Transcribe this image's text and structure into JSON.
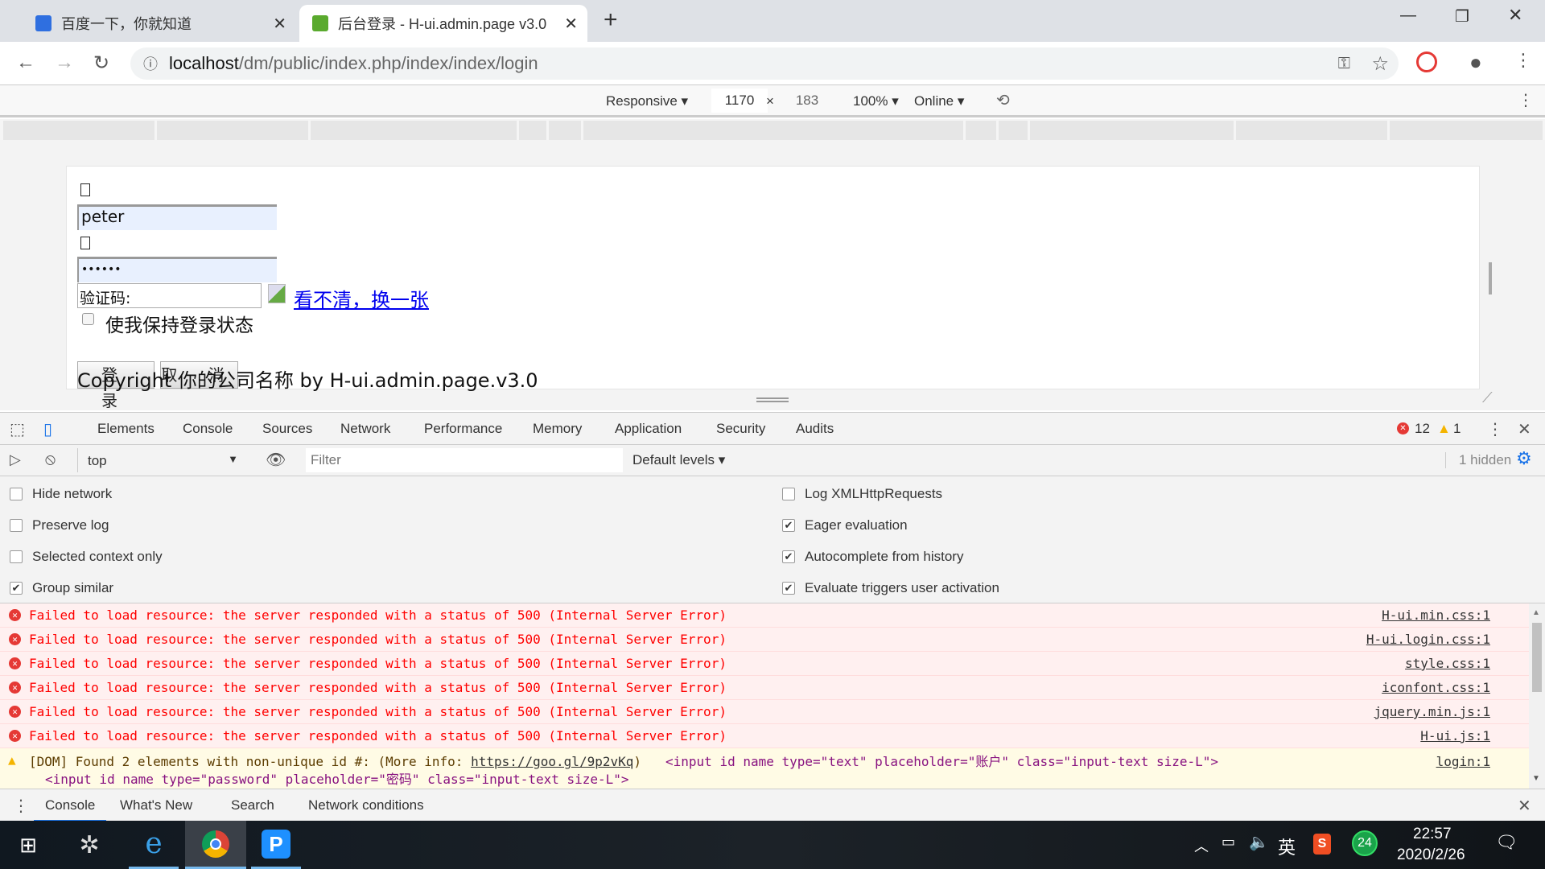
{
  "browser": {
    "tabs": [
      {
        "title": "百度一下，你就知道",
        "active": false
      },
      {
        "title": "后台登录 - H-ui.admin.page v3.0",
        "active": true
      }
    ],
    "new_tab": "+",
    "url_host": "localhost",
    "url_path": "/dm/public/index.php/index/index/login"
  },
  "device_toolbar": {
    "mode": "Responsive",
    "width": "1170",
    "times": "×",
    "height": "183",
    "zoom": "100%",
    "network": "Online"
  },
  "page": {
    "username": "peter",
    "password": "••••••",
    "captcha_placeholder": "验证码:",
    "captcha_refresh_link": "看不清，换一张",
    "remember_label": "使我保持登录状态",
    "login_button": "登 录",
    "cancel_button": "取 消",
    "copyright": "Copyright 你的公司名称 by H-ui.admin.page.v3.0"
  },
  "devtools": {
    "tabs": [
      "Elements",
      "Console",
      "Sources",
      "Network",
      "Performance",
      "Memory",
      "Application",
      "Security",
      "Audits"
    ],
    "active_tab": "Console",
    "error_count": "12",
    "warning_count": "1",
    "context": "top",
    "filter_placeholder": "Filter",
    "levels": "Default levels",
    "hidden": "1 hidden",
    "settings_left": [
      {
        "label": "Hide network",
        "checked": false
      },
      {
        "label": "Preserve log",
        "checked": false
      },
      {
        "label": "Selected context only",
        "checked": false
      },
      {
        "label": "Group similar",
        "checked": true
      }
    ],
    "settings_right": [
      {
        "label": "Log XMLHttpRequests",
        "checked": false
      },
      {
        "label": "Eager evaluation",
        "checked": true
      },
      {
        "label": "Autocomplete from history",
        "checked": true
      },
      {
        "label": "Evaluate triggers user activation",
        "checked": true
      }
    ],
    "errors": [
      {
        "text": "Failed to load resource: the server responded with a status of 500 (Internal Server Error)",
        "source": "H-ui.min.css:1"
      },
      {
        "text": "Failed to load resource: the server responded with a status of 500 (Internal Server Error)",
        "source": "H-ui.login.css:1"
      },
      {
        "text": "Failed to load resource: the server responded with a status of 500 (Internal Server Error)",
        "source": "style.css:1"
      },
      {
        "text": "Failed to load resource: the server responded with a status of 500 (Internal Server Error)",
        "source": "iconfont.css:1"
      },
      {
        "text": "Failed to load resource: the server responded with a status of 500 (Internal Server Error)",
        "source": "jquery.min.js:1"
      },
      {
        "text": "Failed to load resource: the server responded with a status of 500 (Internal Server Error)",
        "source": "H-ui.js:1"
      }
    ],
    "warning": {
      "text": "[DOM] Found 2 elements with non-unique id #: (More info: ",
      "link": "https://goo.gl/9p2vKq",
      "close": ")",
      "el1": "<input id name type=\"text\" placeholder=\"账户\" class=\"input-text size-L\">",
      "el2": "<input id name type=\"password\" placeholder=\"密码\" class=\"input-text size-L\">",
      "source": "login:1"
    },
    "drawer_tabs": [
      "Console",
      "What's New",
      "Search",
      "Network conditions"
    ]
  },
  "taskbar": {
    "time": "22:57",
    "date": "2020/2/26",
    "ime": "英",
    "badge": "24",
    "apps": [
      "windows-start",
      "app-pinwheel",
      "internet-explorer",
      "chrome",
      "p-app"
    ]
  },
  "colors": {
    "error": "#ff0000",
    "error_bg": "#fff0f0",
    "warning_bg": "#fffbe5",
    "link": "#0000ee",
    "accent": "#1a73e8"
  }
}
